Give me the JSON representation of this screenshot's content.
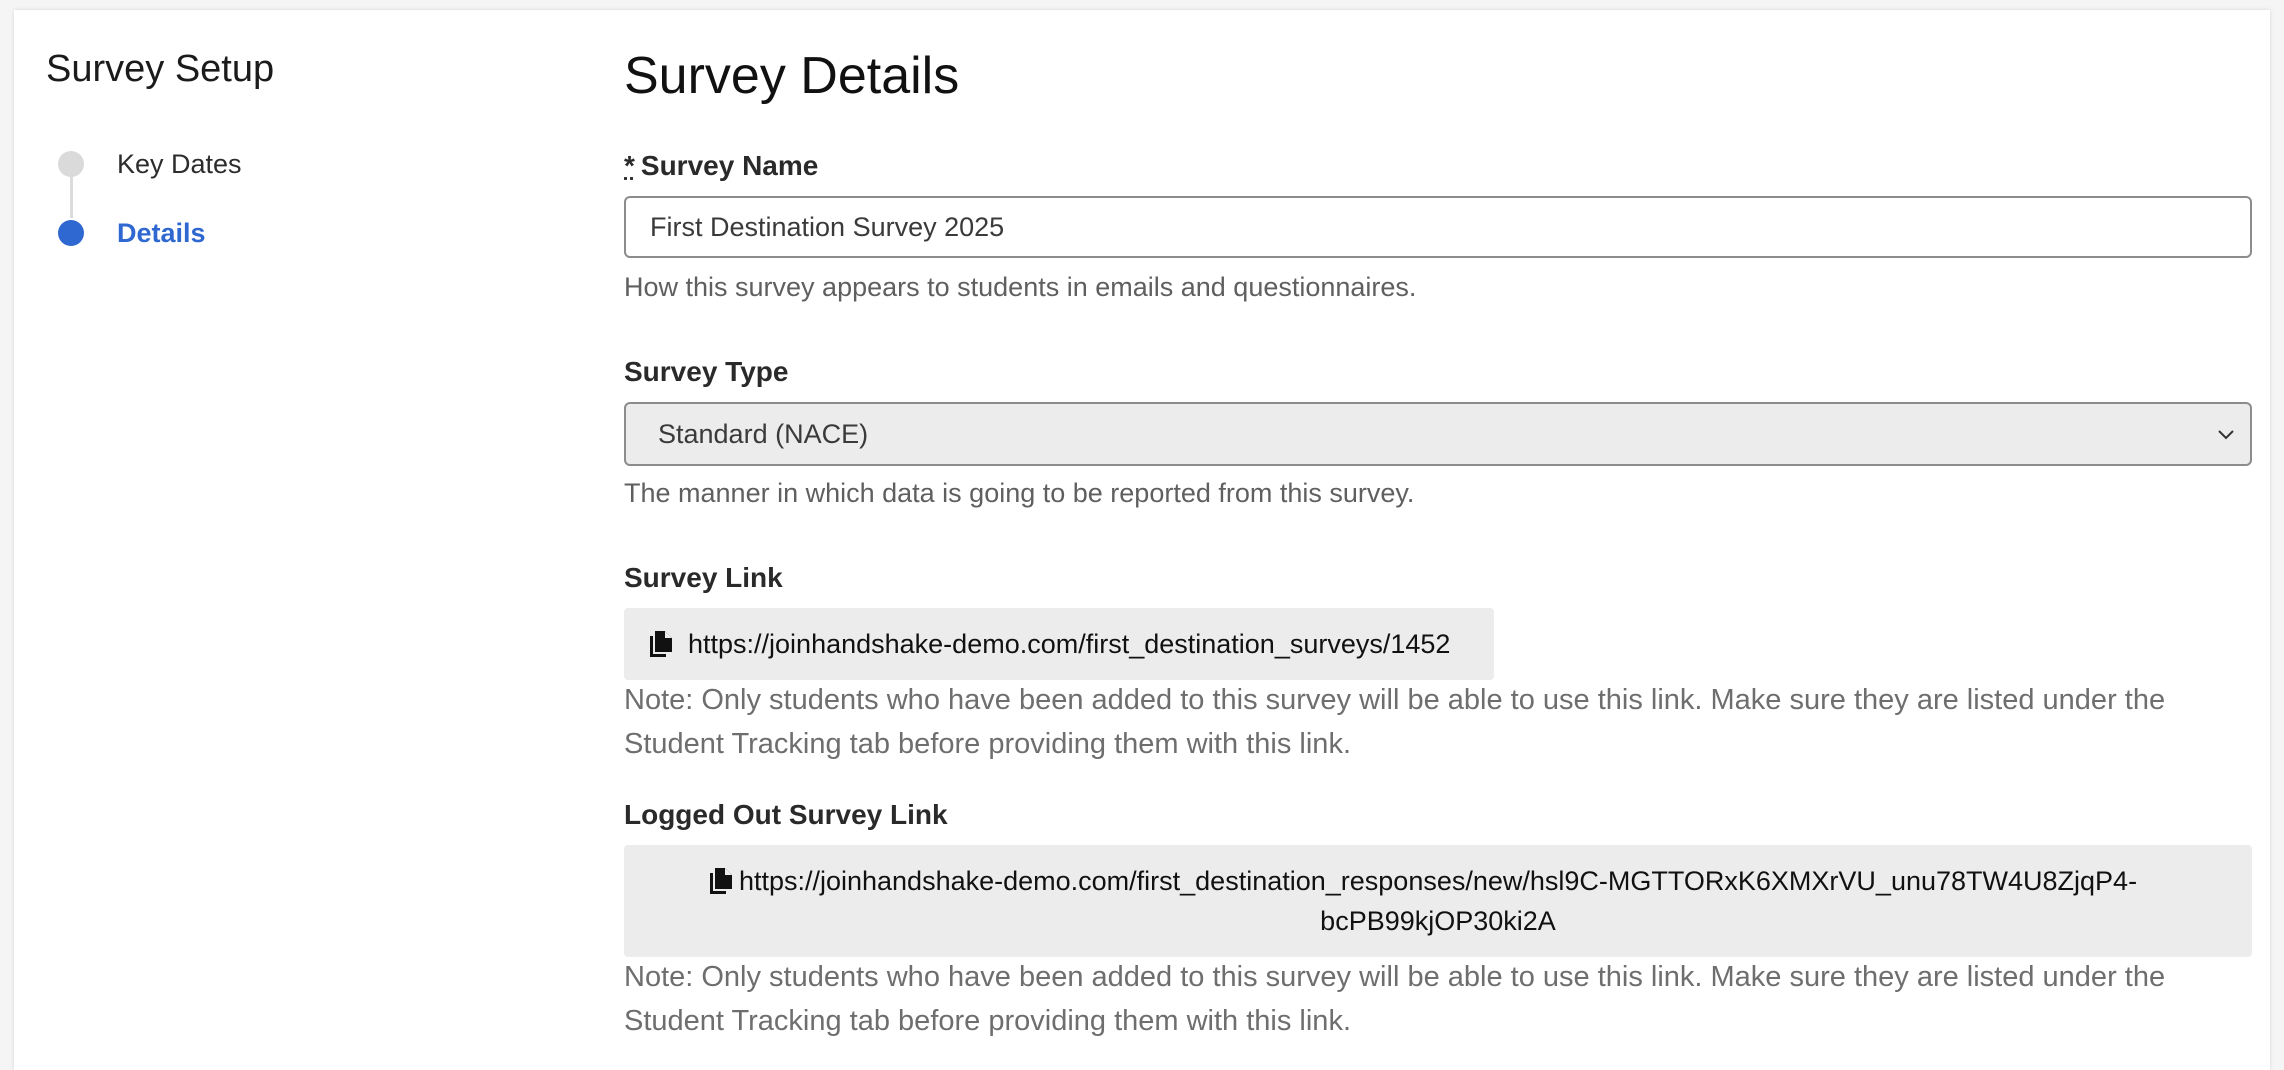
{
  "sidebar": {
    "title": "Survey Setup",
    "steps": [
      {
        "label": "Key Dates",
        "state": "inactive"
      },
      {
        "label": "Details",
        "state": "active"
      }
    ]
  },
  "main": {
    "title": "Survey Details",
    "survey_name": {
      "required_marker": "*",
      "label": "Survey Name",
      "value": "First Destination Survey 2025",
      "help": "How this survey appears to students in emails and questionnaires."
    },
    "survey_type": {
      "label": "Survey Type",
      "selected": "Standard (NACE)",
      "help": "The manner in which data is going to be reported from this survey."
    },
    "survey_link": {
      "label": "Survey Link",
      "url": "https://joinhandshake-demo.com/first_destination_surveys/1452",
      "note": "Note: Only students who have been added to this survey will be able to use this link. Make sure they are listed under the Student Tracking tab before providing them with this link."
    },
    "logged_out_link": {
      "label": "Logged Out Survey Link",
      "url": "https://joinhandshake-demo.com/first_destination_responses/new/hsl9C-MGTTORxK6XMXrVU_unu78TW4U8ZjqP4-bcPB99kjOP30ki2A",
      "note": "Note: Only students who have been added to this survey will be able to use this link. Make sure they are listed under the Student Tracking tab before providing them with this link."
    }
  },
  "icons": {
    "copy": "copy-icon",
    "chevron": "chevron-down-icon"
  },
  "colors": {
    "accent": "#2f68d0",
    "inactive_dot": "#dadada",
    "link_box_bg": "#ececec"
  }
}
